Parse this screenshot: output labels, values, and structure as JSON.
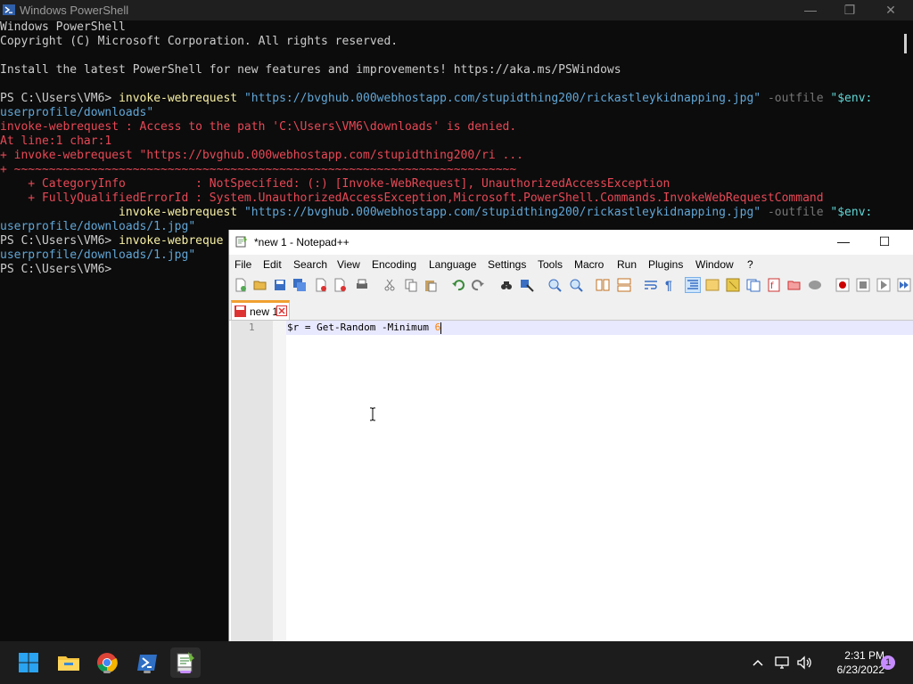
{
  "powershell": {
    "title": "Windows PowerShell",
    "lines": [
      [
        {
          "t": "Windows PowerShell",
          "c": "w"
        }
      ],
      [
        {
          "t": "Copyright (C) Microsoft Corporation. All rights reserved.",
          "c": "w"
        }
      ],
      [],
      [
        {
          "t": "Install the latest PowerShell for new features and improvements! https://aka.ms/PSWindows",
          "c": "w"
        }
      ],
      [],
      [
        {
          "t": "PS C:\\Users\\VM6> ",
          "c": "w"
        },
        {
          "t": "invoke-webrequest ",
          "c": "y"
        },
        {
          "t": "\"https://bvghub.000webhostapp.com/stupidthing200/rickastleykidnapping.jpg\" ",
          "c": "cy"
        },
        {
          "t": "-outfile ",
          "c": "g"
        },
        {
          "t": "\"$env:",
          "c": "s"
        }
      ],
      [
        {
          "t": "userprofile/downloads\"",
          "c": "cy"
        }
      ],
      [
        {
          "t": "invoke-webrequest : Access to the path 'C:\\Users\\VM6\\downloads' is denied.",
          "c": "r"
        }
      ],
      [
        {
          "t": "At line:1 char:1",
          "c": "r"
        }
      ],
      [
        {
          "t": "+ invoke-webrequest \"https://bvghub.000webhostapp.com/stupidthing200/ri ...",
          "c": "r"
        }
      ],
      [
        {
          "t": "+ ~~~~~~~~~~~~~~~~~~~~~~~~~~~~~~~~~~~~~~~~~~~~~~~~~~~~~~~~~~~~~~~~~~~~~~~~",
          "c": "r"
        }
      ],
      [
        {
          "t": "    + CategoryInfo          : NotSpecified: (:) [Invoke-WebRequest], UnauthorizedAccessException",
          "c": "r"
        }
      ],
      [
        {
          "t": "    + FullyQualifiedErrorId : System.UnauthorizedAccessException,Microsoft.PowerShell.Commands.InvokeWebRequestCommand",
          "c": "r"
        }
      ],
      [
        {
          "t": "                 invoke-webrequest ",
          "c": "y"
        },
        {
          "t": "\"https://bvghub.000webhostapp.com/stupidthing200/rickastleykidnapping.jpg\" ",
          "c": "cy"
        },
        {
          "t": "-outfile ",
          "c": "g"
        },
        {
          "t": "\"$env:",
          "c": "s"
        }
      ],
      [
        {
          "t": "userprofile/downloads/1.jpg\"",
          "c": "cy"
        }
      ],
      [
        {
          "t": "PS C:\\Users\\VM6> ",
          "c": "w"
        },
        {
          "t": "invoke-webreque",
          "c": "y"
        }
      ],
      [
        {
          "t": "userprofile/downloads/1.jpg\"",
          "c": "cy"
        }
      ],
      [
        {
          "t": "PS C:\\Users\\VM6>",
          "c": "w"
        }
      ]
    ]
  },
  "notepad": {
    "title": "*new 1 - Notepad++",
    "menu": [
      "File",
      "Edit",
      "Search",
      "View",
      "Encoding",
      "Language",
      "Settings",
      "Tools",
      "Macro",
      "Run",
      "Plugins",
      "Window",
      "?"
    ],
    "tab_label": "new 1",
    "line_number": "1",
    "code_prefix": "$r = Get-Random -Minimum ",
    "code_number": "6"
  },
  "taskbar": {
    "time": "2:31 PM",
    "date": "6/23/2022",
    "notification_count": "1",
    "apps": [
      "start-button",
      "file-explorer",
      "chrome",
      "powershell",
      "notepad-plus-plus"
    ]
  },
  "colors": {
    "console_bg": "#0c0c0c",
    "error_red": "#e74856",
    "command_yellow": "#f9f1a5",
    "string_blue": "#61a6d6",
    "accent_purple": "#c68cff"
  }
}
